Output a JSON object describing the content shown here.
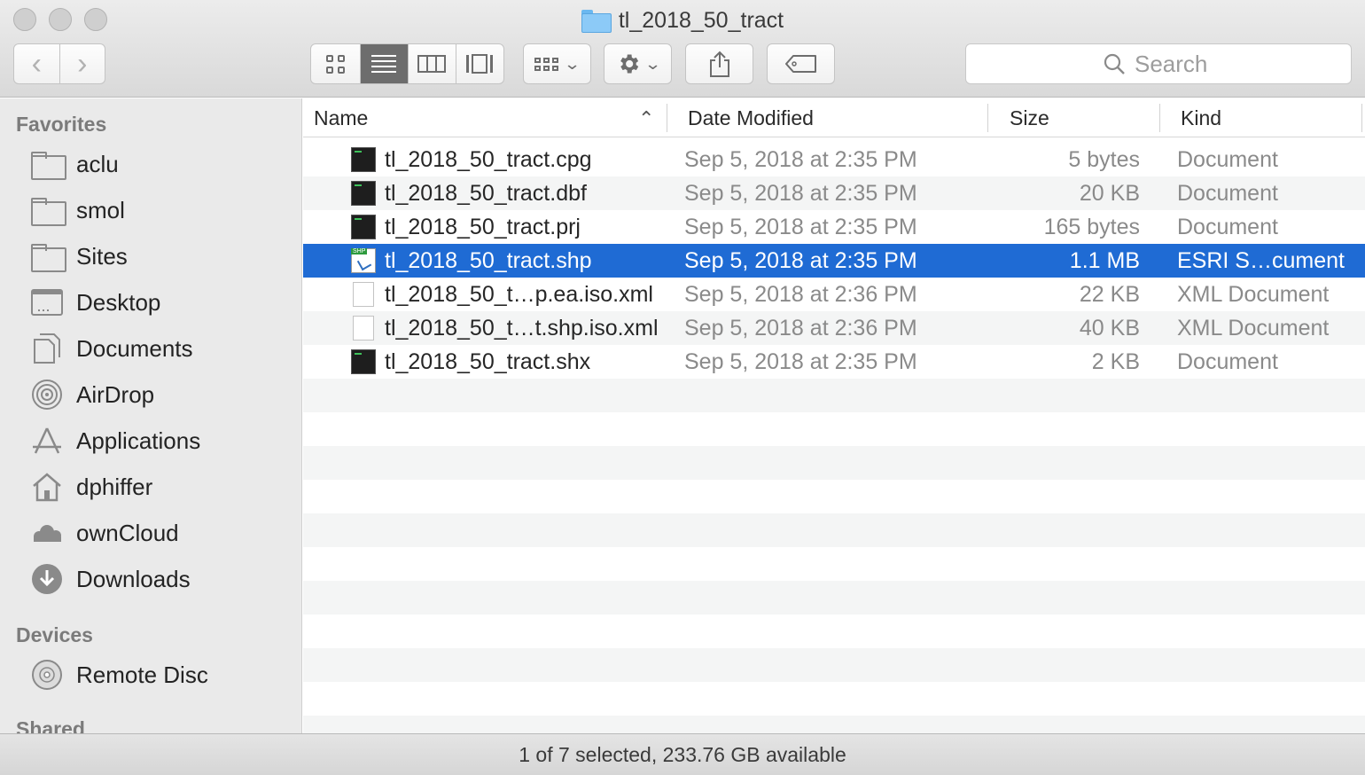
{
  "window": {
    "title": "tl_2018_50_tract"
  },
  "toolbar": {
    "back_glyph": "‹",
    "forward_glyph": "›",
    "search_placeholder": "Search"
  },
  "sidebar": {
    "favorites_header": "Favorites",
    "favorites": [
      {
        "label": "aclu",
        "icon": "folder-icon"
      },
      {
        "label": "smol",
        "icon": "folder-icon"
      },
      {
        "label": "Sites",
        "icon": "folder-icon"
      },
      {
        "label": "Desktop",
        "icon": "desktop-icon"
      },
      {
        "label": "Documents",
        "icon": "documents-icon"
      },
      {
        "label": "AirDrop",
        "icon": "airdrop-icon"
      },
      {
        "label": "Applications",
        "icon": "applications-icon"
      },
      {
        "label": "dphiffer",
        "icon": "home-icon"
      },
      {
        "label": "ownCloud",
        "icon": "cloud-icon"
      },
      {
        "label": "Downloads",
        "icon": "downloads-icon"
      }
    ],
    "devices_header": "Devices",
    "devices": [
      {
        "label": "Remote Disc",
        "icon": "disc-icon"
      }
    ],
    "shared_header": "Shared"
  },
  "columns": {
    "name": "Name",
    "date": "Date Modified",
    "size": "Size",
    "kind": "Kind"
  },
  "files": [
    {
      "name": "tl_2018_50_tract.cpg",
      "date": "Sep 5, 2018 at 2:35 PM",
      "size": "5 bytes",
      "kind": "Document",
      "icon": "terminal-doc-icon",
      "selected": false
    },
    {
      "name": "tl_2018_50_tract.dbf",
      "date": "Sep 5, 2018 at 2:35 PM",
      "size": "20 KB",
      "kind": "Document",
      "icon": "terminal-doc-icon",
      "selected": false
    },
    {
      "name": "tl_2018_50_tract.prj",
      "date": "Sep 5, 2018 at 2:35 PM",
      "size": "165 bytes",
      "kind": "Document",
      "icon": "terminal-doc-icon",
      "selected": false
    },
    {
      "name": "tl_2018_50_tract.shp",
      "date": "Sep 5, 2018 at 2:35 PM",
      "size": "1.1 MB",
      "kind": "ESRI S…cument",
      "icon": "shp-doc-icon",
      "selected": true
    },
    {
      "name": "tl_2018_50_t…p.ea.iso.xml",
      "date": "Sep 5, 2018 at 2:36 PM",
      "size": "22 KB",
      "kind": "XML Document",
      "icon": "blank-doc-icon",
      "selected": false
    },
    {
      "name": "tl_2018_50_t…t.shp.iso.xml",
      "date": "Sep 5, 2018 at 2:36 PM",
      "size": "40 KB",
      "kind": "XML Document",
      "icon": "blank-doc-icon",
      "selected": false
    },
    {
      "name": "tl_2018_50_tract.shx",
      "date": "Sep 5, 2018 at 2:35 PM",
      "size": "2 KB",
      "kind": "Document",
      "icon": "terminal-doc-icon",
      "selected": false
    }
  ],
  "status": {
    "text": "1 of 7 selected, 233.76 GB available"
  },
  "colors": {
    "selection": "#1f6bd4",
    "sidebar_bg": "#eaeaea",
    "folder_blue": "#8ccaf7"
  }
}
